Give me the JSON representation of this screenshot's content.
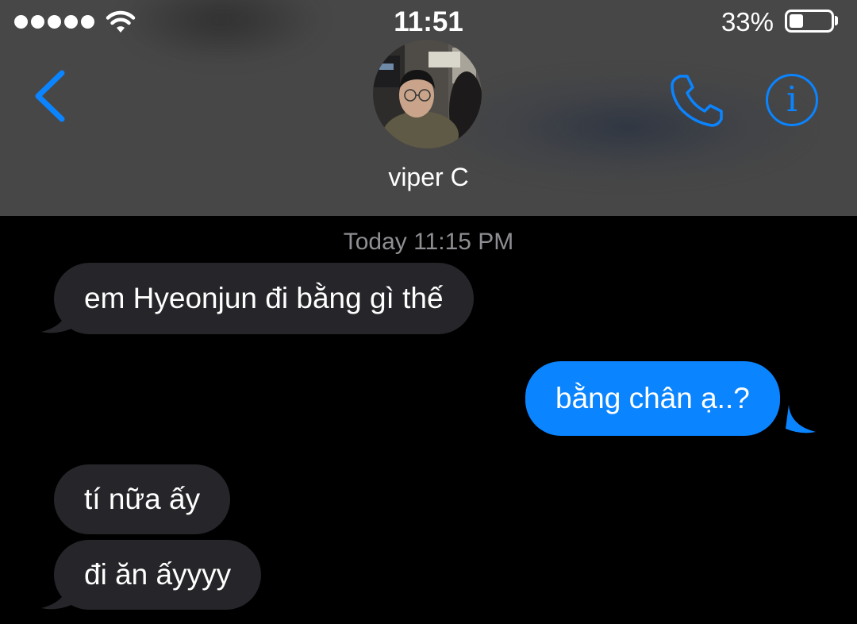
{
  "status_bar": {
    "time": "11:51",
    "battery_percent": "33%",
    "battery_level": 0.33,
    "signal_bars": 5
  },
  "header": {
    "contact_name": "viper C",
    "back_icon": "chevron-left-icon",
    "call_icon": "phone-icon",
    "info_icon": "info-icon",
    "info_glyph": "i",
    "accent_color": "#0a84ff"
  },
  "conversation": {
    "timestamp": "Today 11:15 PM",
    "messages": [
      {
        "direction": "incoming",
        "text": "em Hyeonjun đi bằng gì thế"
      },
      {
        "direction": "outgoing",
        "text": "bằng chân ạ..?"
      },
      {
        "direction": "incoming",
        "text": "tí nữa ấy"
      },
      {
        "direction": "incoming",
        "text": "đi ăn ấyyyy"
      }
    ]
  },
  "colors": {
    "incoming_bubble": "#262529",
    "outgoing_bubble": "#0a84ff",
    "header_background": "#474747",
    "background": "#000000"
  }
}
